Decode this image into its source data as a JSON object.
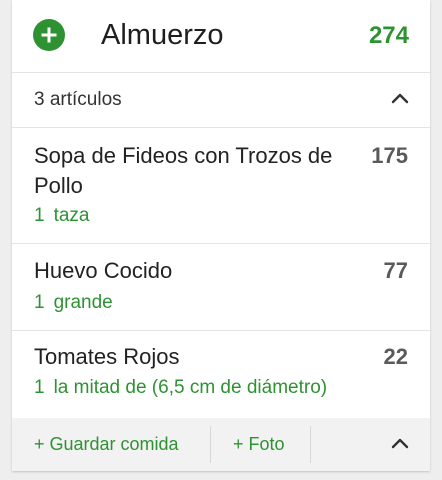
{
  "meal": {
    "name": "Almuerzo",
    "total_calories": "274",
    "add_icon": "plus-circle-icon",
    "accent_color": "#2e9233"
  },
  "summary": {
    "items_count_label": "3 artículos",
    "collapse_icon": "chevron-up-icon"
  },
  "foods": [
    {
      "name": "Sopa de Fideos con Trozos de Pollo",
      "quantity": "1",
      "unit": "taza",
      "calories": "175"
    },
    {
      "name": "Huevo Cocido",
      "quantity": "1",
      "unit": "grande",
      "calories": "77"
    },
    {
      "name": "Tomates Rojos",
      "quantity": "1",
      "unit": "la mitad de (6,5 cm de diámetro)",
      "calories": "22"
    }
  ],
  "footer": {
    "save_meal_label": "+ Guardar comida",
    "photo_label": "+ Foto",
    "collapse_icon": "chevron-up-icon"
  }
}
